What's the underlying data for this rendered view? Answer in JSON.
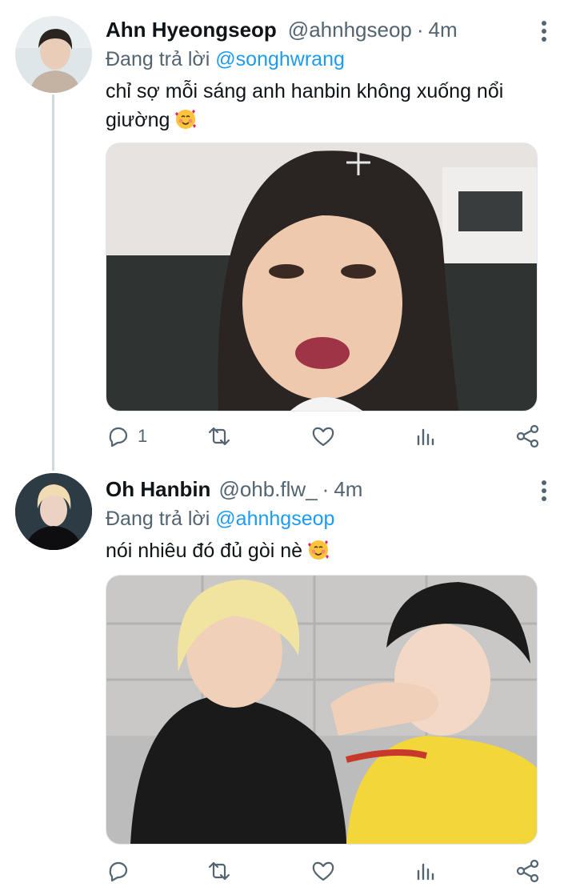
{
  "tweets": [
    {
      "name": "Ahn Hyeongseop",
      "handle": "@ahnhgseop",
      "separator": "·",
      "time": "4m",
      "replying_prefix": "Đang trả lời",
      "replying_to": "@songhwrang",
      "text": "chỉ sợ mỗi sáng anh hanbin không xuống nổi giường",
      "emoji": "smiling-face-with-hearts",
      "media_description": "photo",
      "reply_count": "1",
      "retweet_count": "",
      "like_count": ""
    },
    {
      "name": "Oh Hanbin",
      "handle": "@ohb.flw_",
      "separator": "·",
      "time": "4m",
      "replying_prefix": "Đang trả lời",
      "replying_to": "@ahnhgseop",
      "text": "nói nhiêu đó đủ gòi nè",
      "emoji": "smiling-face-with-hearts",
      "media_description": "photo",
      "reply_count": "",
      "retweet_count": "",
      "like_count": ""
    }
  ],
  "colors": {
    "accent": "#1d9bf0",
    "secondary_text": "#536471",
    "primary_text": "#0f1419",
    "thread_line": "#cfd9de"
  },
  "icons": [
    "reply-icon",
    "retweet-icon",
    "like-icon",
    "analytics-icon",
    "share-icon",
    "more-icon"
  ]
}
